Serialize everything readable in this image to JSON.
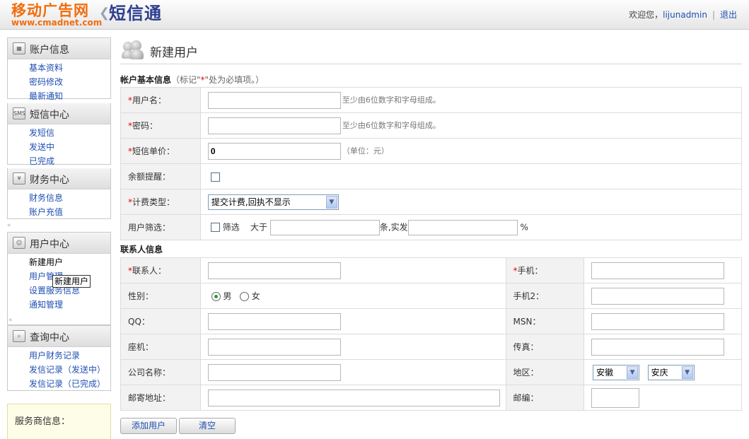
{
  "header": {
    "site_name": "移动广告网",
    "site_url": "www.cmadnet.com",
    "product_name": "短信通",
    "welcome": "欢迎您，",
    "username": "lijunadmin",
    "separator": "|",
    "logout": "退出"
  },
  "sidebar": {
    "sections": [
      {
        "title": "账户信息",
        "icon": "calendar-icon",
        "items": [
          "基本资料",
          "密码修改",
          "最新通知"
        ]
      },
      {
        "title": "短信中心",
        "icon": "sms-icon",
        "icon_text": "SMS",
        "items": [
          "发短信",
          "发送中",
          "已完成"
        ]
      },
      {
        "title": "财务中心",
        "icon": "finance-icon",
        "items": [
          "财务信息",
          "账户充值"
        ]
      },
      {
        "title": "用户中心",
        "icon": "users-icon",
        "items": [
          "新建用户",
          "用户管理",
          "设置服务信息",
          "通知管理"
        ]
      },
      {
        "title": "查询中心",
        "icon": "magnifier-icon",
        "items": [
          "用户财务记录",
          "发信记录（发送中）",
          "发信记录（已完成）"
        ]
      }
    ],
    "collapse_glyph": "«",
    "tooltip": "新建用户",
    "provider_info": "服务商信息："
  },
  "page": {
    "title": "新建用户",
    "account_section": {
      "title": "帐户基本信息",
      "note_prefix": "（标记\"",
      "note_star": "*",
      "note_suffix": "\"处为必填项。）"
    },
    "fields": {
      "username": {
        "label": "用户名：",
        "value": "",
        "hint": "至少由6位数字和字母组成。"
      },
      "password": {
        "label": "密码：",
        "value": "",
        "hint": "至少由6位数字和字母组成。"
      },
      "unit_price": {
        "label": "短信单价：",
        "value": "0",
        "hint": "（单位：元）"
      },
      "balance_alert": {
        "label": "余额提醒：",
        "checked": false
      },
      "billing_type": {
        "label": "计费类型：",
        "selected": "提交计费,回执不显示"
      },
      "user_filter": {
        "label": "用户筛选：",
        "checkbox_label": "筛选",
        "greater_than": "大于",
        "count_unit": "条,实发",
        "percent": "%"
      }
    },
    "contact_section": {
      "title": "联系人信息"
    },
    "contact": {
      "contact_person": {
        "label": "联系人："
      },
      "mobile": {
        "label": "手机："
      },
      "gender": {
        "label": "性别：",
        "options": [
          "男",
          "女"
        ],
        "selected": "男"
      },
      "mobile2": {
        "label": "手机2："
      },
      "qq": {
        "label": "QQ："
      },
      "msn": {
        "label": "MSN："
      },
      "landline": {
        "label": "座机："
      },
      "fax": {
        "label": "传真："
      },
      "company": {
        "label": "公司名称："
      },
      "region": {
        "label": "地区：",
        "province": "安徽",
        "city": "安庆"
      },
      "address": {
        "label": "邮寄地址："
      },
      "postcode": {
        "label": "邮编："
      }
    },
    "buttons": {
      "add": "添加用户",
      "clear": "清空"
    }
  },
  "colors": {
    "brand_orange": "#f26d0c",
    "brand_blue": "#2e3f8f",
    "link": "#1f4fb3",
    "required": "#ee0000"
  }
}
